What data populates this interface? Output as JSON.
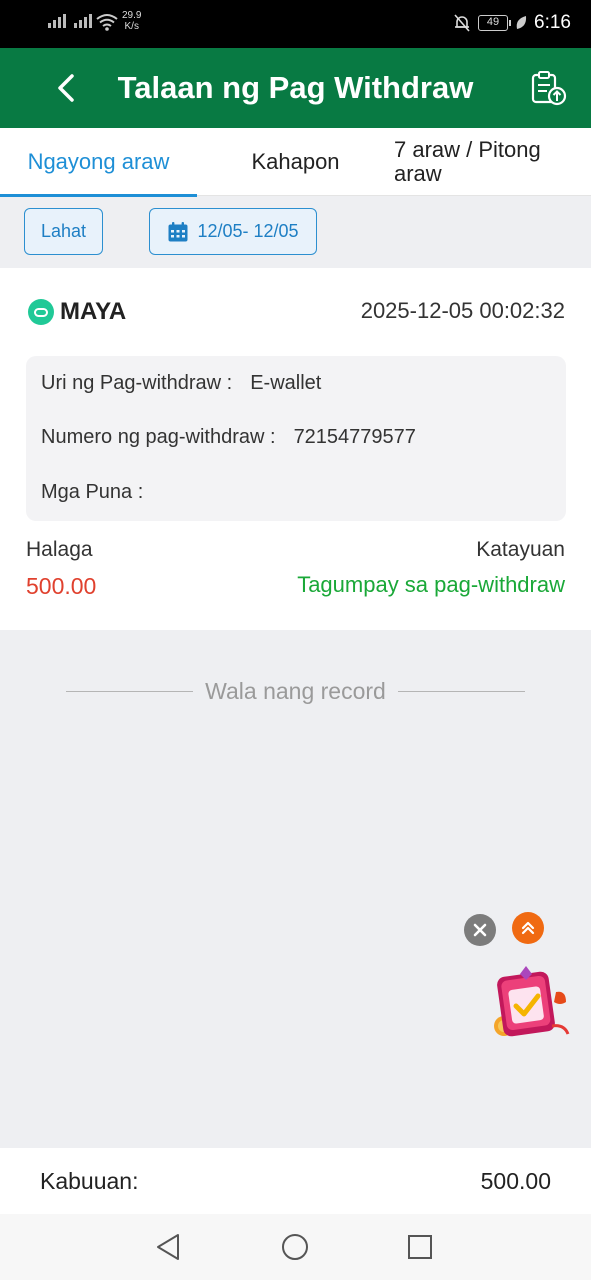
{
  "status_bar": {
    "net_speed_value": "29.9",
    "net_speed_unit": "K/s",
    "battery": "49",
    "time": "6:16",
    "icons": [
      "signal-icon",
      "signal-x-icon",
      "wifi-icon",
      "mute-bell-icon",
      "battery-icon",
      "leaf-icon"
    ]
  },
  "header": {
    "title": "Talaan ng Pag Withdraw",
    "icons": [
      "back-arrow-icon",
      "document-upload-icon"
    ],
    "background_color": "#087a43"
  },
  "tabs": [
    {
      "label": "Ngayong araw",
      "active": true
    },
    {
      "label": "Kahapon",
      "active": false
    },
    {
      "label": "7 araw / Pitong araw",
      "active": false
    }
  ],
  "filters": {
    "all_label": "Lahat",
    "date_range": "12/05- 12/05",
    "date_icon": "calendar-icon"
  },
  "record": {
    "method": "MAYA",
    "datetime": "2025-12-05 00:02:32",
    "type_label": "Uri ng Pag-withdraw :",
    "type_value": "E-wallet",
    "number_label": "Numero ng pag-withdraw :",
    "number_value": "72154779577",
    "remarks_label": "Mga Puna :",
    "remarks_value": "",
    "amount_label": "Halaga",
    "amount_value": "500.00",
    "status_label": "Katayuan",
    "status_value": "Tagumpay sa pag-withdraw",
    "amount_color": "#e0412e",
    "status_color": "#1aa838"
  },
  "list_end_text": "Wala nang record",
  "floating": {
    "icons": [
      "close-icon",
      "double-chevron-up-icon",
      "promo-gift-icon"
    ]
  },
  "total": {
    "label": "Kabuuan:",
    "value": "500.00"
  },
  "nav": {
    "icons": [
      "nav-back-icon",
      "nav-home-icon",
      "nav-recent-icon"
    ]
  }
}
